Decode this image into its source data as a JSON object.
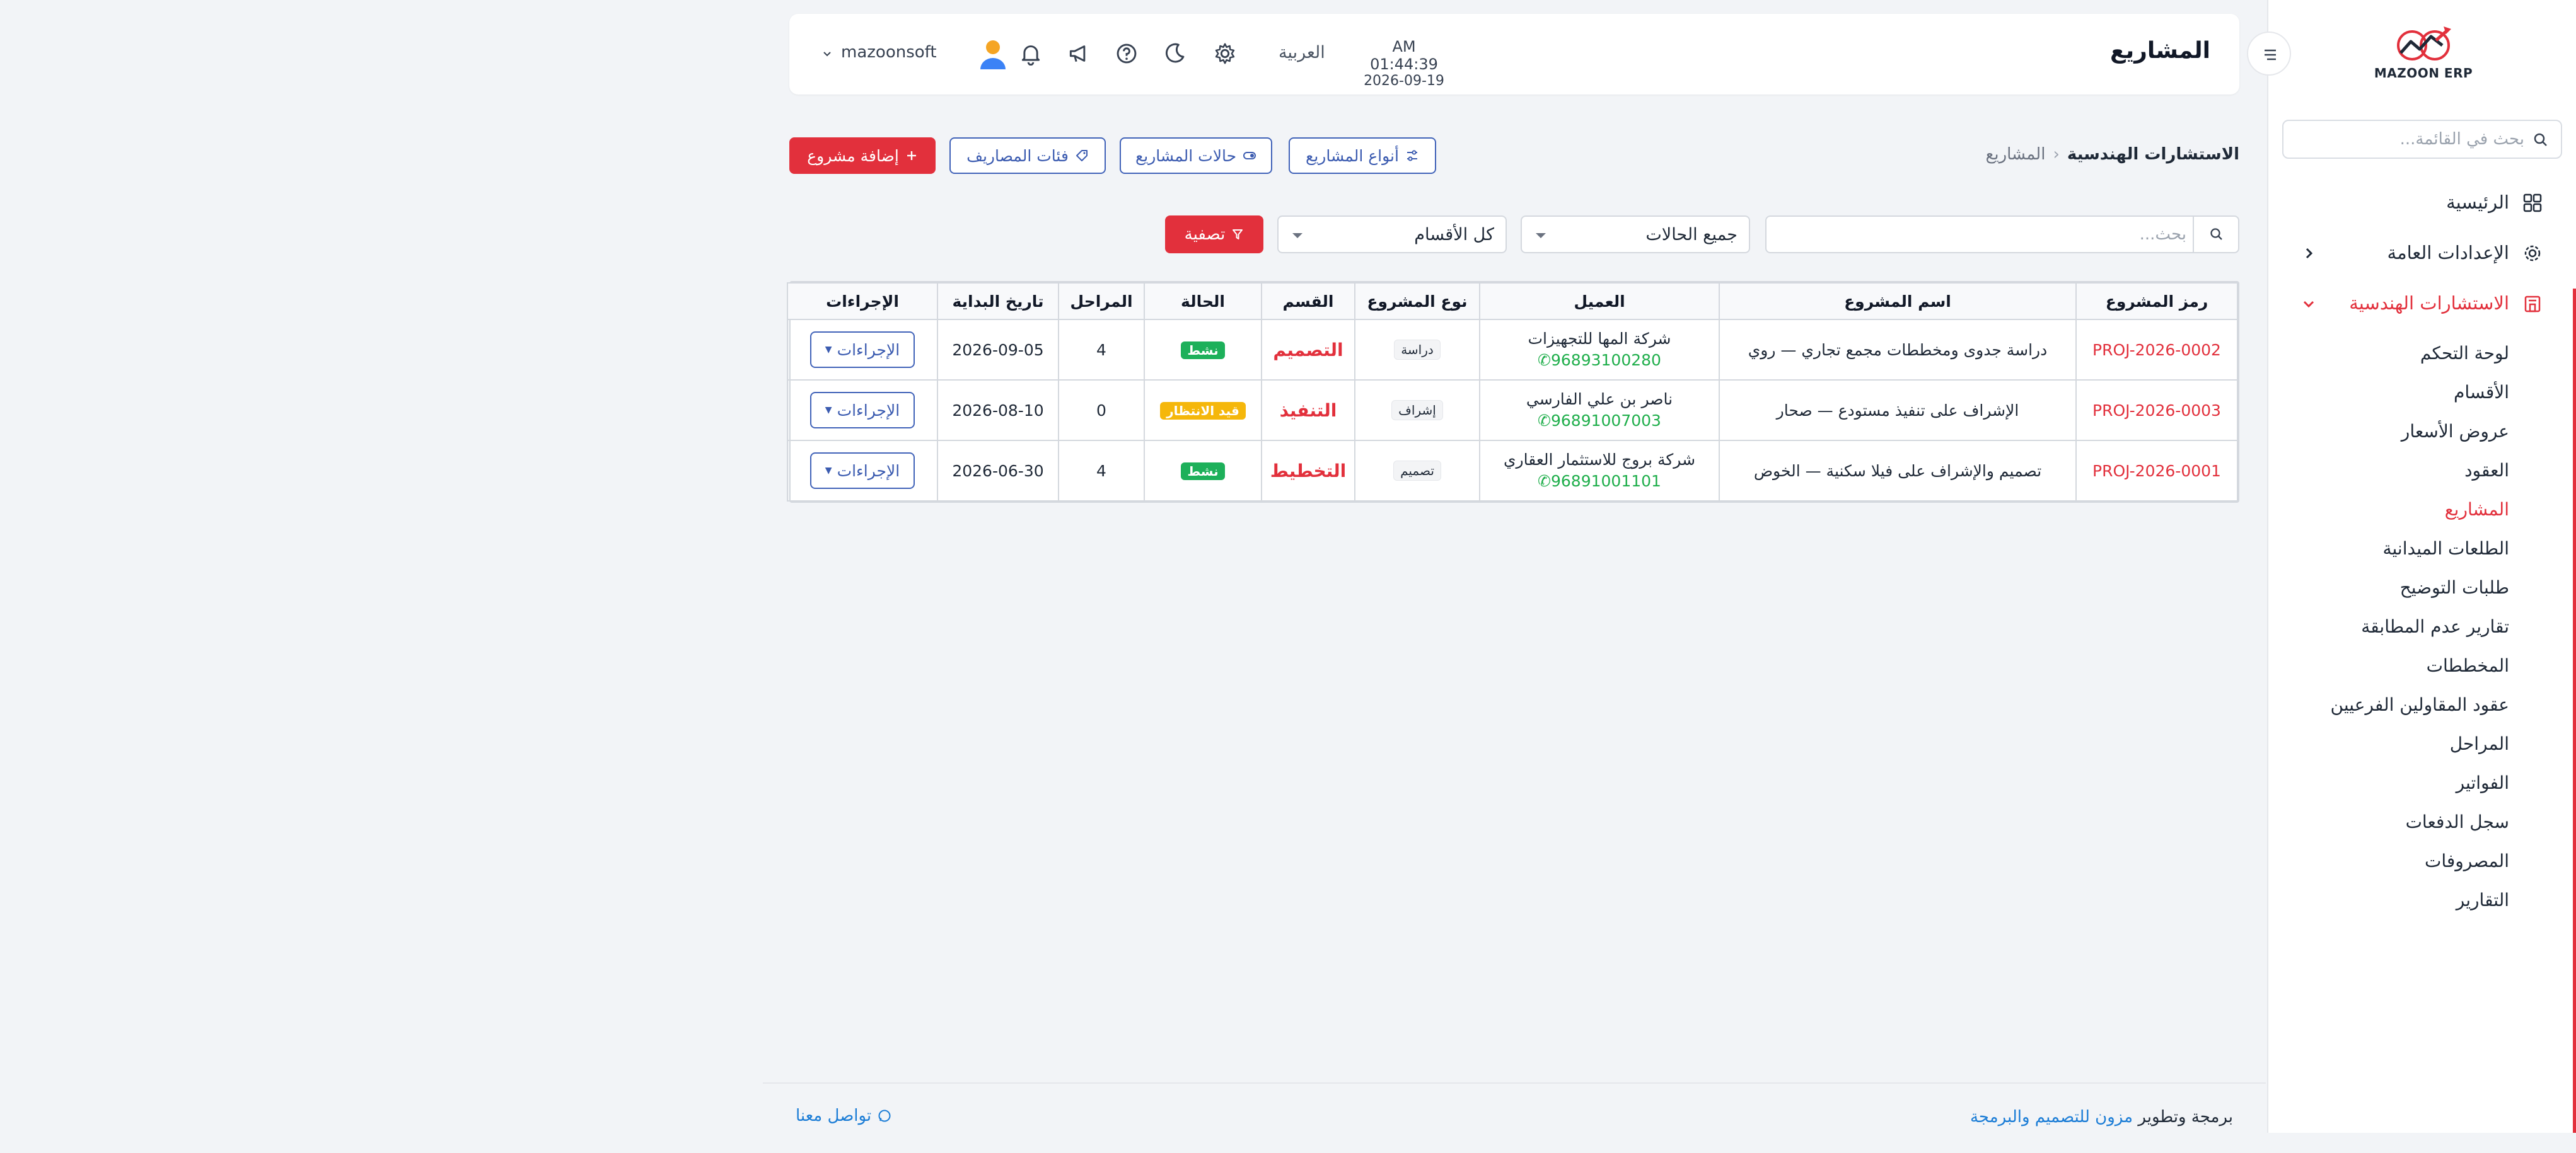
{
  "app": {
    "brand": "MAZOON ERP",
    "accent": "#e2303c"
  },
  "sidebar": {
    "search_placeholder": "بحث في القائمة...",
    "items": [
      {
        "label": "الرئيسية",
        "icon": "grid-icon"
      },
      {
        "label": "الإعدادات العامة",
        "icon": "gear-icon"
      },
      {
        "label": "الاستشارات الهندسية",
        "icon": "building-icon"
      }
    ],
    "subitems": [
      "لوحة التحكم",
      "الأقسام",
      "عروض الأسعار",
      "العقود",
      "المشاريع",
      "الطلعات الميدانية",
      "طلبات التوضيح",
      "تقارير عدم المطابقة",
      "المخططات",
      "عقود المقاولين الفرعيين",
      "المراحل",
      "الفواتير",
      "سجل الدفعات",
      "المصروفات",
      "التقارير"
    ]
  },
  "header": {
    "title": "المشاريع",
    "time": "AM 01:44:39",
    "date": "2026-09-19",
    "language": "العربية",
    "username": "mazoonsoft"
  },
  "breadcrumb": {
    "current": "الاستشارات الهندسية",
    "link": "المشاريع"
  },
  "toolbar": {
    "types": "أنواع المشاريع",
    "statuses": "حالات المشاريع",
    "expense_categories": "فئات المصاريف",
    "add_project": "إضافة مشروع"
  },
  "filters": {
    "search_placeholder": "بحث...",
    "status_select": "جميع الحالات",
    "dept_select": "كل الأقسام",
    "filter_button": "تصفية"
  },
  "table": {
    "headers": [
      "رمز المشروع",
      "اسم المشروع",
      "العميل",
      "نوع المشروع",
      "القسم",
      "الحالة",
      "المراحل",
      "تاريخ البداية",
      "الإجراءات"
    ],
    "rows": [
      {
        "code": "PROJ-2026-0002",
        "name": "دراسة جدوى ومخططات مجمع تجاري — روي",
        "client": "شركة المها للتجهيزات",
        "phone": "96893100280",
        "type": "دراسة",
        "dept": "التصميم",
        "status": "نشط",
        "status_color": "#1db05a",
        "stages": "4",
        "start": "2026-09-05",
        "action": "الإجراءات"
      },
      {
        "code": "PROJ-2026-0003",
        "name": "الإشراف على تنفيذ مستودع — صحار",
        "client": "ناصر بن علي الفارسي",
        "phone": "96891007003",
        "type": "إشراف",
        "dept": "التنفيذ",
        "status": "قيد الانتظار",
        "status_color": "#f5b70b",
        "stages": "0",
        "start": "2026-08-10",
        "action": "الإجراءات"
      },
      {
        "code": "PROJ-2026-0001",
        "name": "تصميم والإشراف على فيلا سكنية — الخوض",
        "client": "شركة بروج للاستثمار العقاري",
        "phone": "96891001101",
        "type": "تصميم",
        "dept": "التخطيط",
        "status": "نشط",
        "status_color": "#1db05a",
        "stages": "4",
        "start": "2026-06-30",
        "action": "الإجراءات"
      }
    ]
  },
  "footer": {
    "prefix": "برمجة وتطوير",
    "company": "مزون للتصميم والبرمجة",
    "contact": "تواصل معنا"
  }
}
